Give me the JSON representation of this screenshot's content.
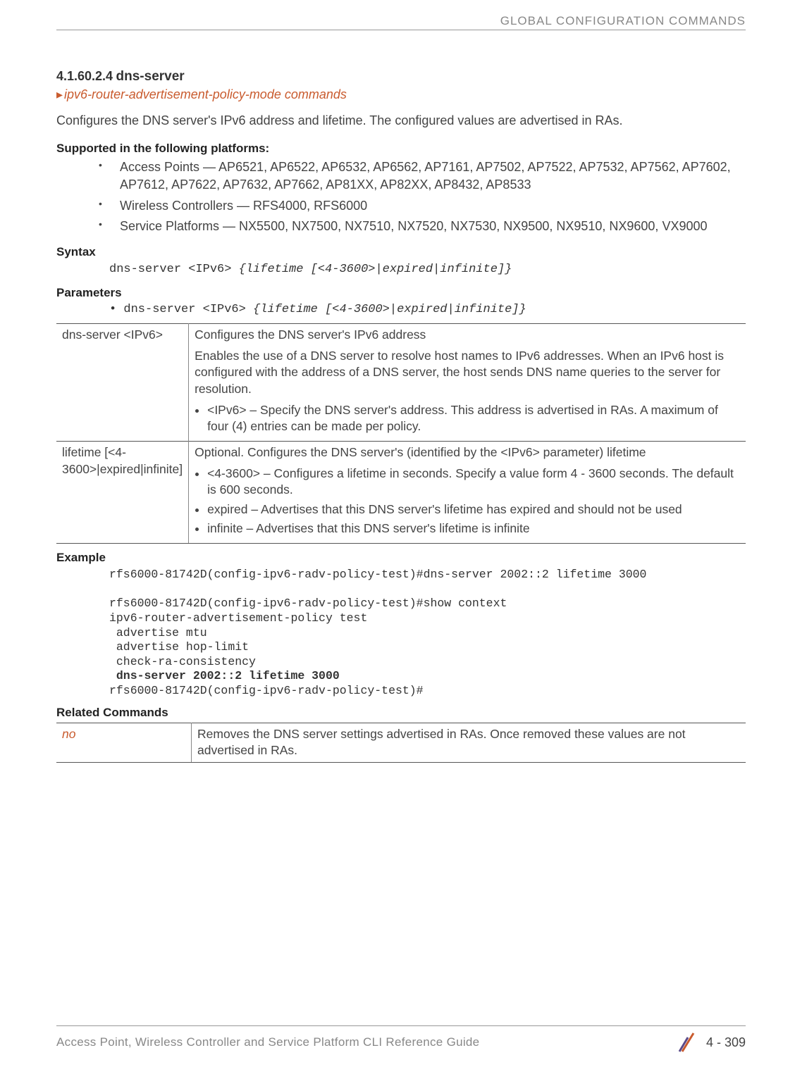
{
  "header": {
    "right": "GLOBAL CONFIGURATION COMMANDS"
  },
  "section": {
    "number": "4.1.60.2.4",
    "title": "dns-server"
  },
  "link": "ipv6-router-advertisement-policy-mode commands",
  "intro": "Configures the DNS server's IPv6 address and lifetime. The configured values are advertised in RAs.",
  "supported_head": "Supported in the following platforms:",
  "platforms": [
    "Access Points — AP6521, AP6522, AP6532, AP6562, AP7161, AP7502, AP7522, AP7532, AP7562, AP7602, AP7612, AP7622, AP7632, AP7662, AP81XX, AP82XX, AP8432, AP8533",
    "Wireless Controllers — RFS4000, RFS6000",
    "Service Platforms — NX5500, NX7500, NX7510, NX7520, NX7530, NX9500, NX9510, NX9600, VX9000"
  ],
  "syntax_head": "Syntax",
  "syntax": {
    "plain": "dns-server <IPv6> ",
    "italic": "{lifetime [<4-3600>|expired|infinite]}"
  },
  "parameters_head": "Parameters",
  "param_line": {
    "prefix": "• dns-server <IPv6> ",
    "italic": "{lifetime [<4-3600>|expired|infinite]}"
  },
  "table": {
    "r1": {
      "c1": "dns-server <IPv6>",
      "p1": "Configures the DNS server's IPv6 address",
      "p2": "Enables the use of a DNS server to resolve host names to IPv6 addresses. When an IPv6 host is configured with the address of a DNS server, the host sends DNS name queries to the server for resolution.",
      "b1": "<IPv6> – Specify the DNS server's address. This address is advertised in RAs. A maximum of four (4) entries can be made per policy."
    },
    "r2": {
      "c1": "lifetime [<4-3600>|expired|infinite]",
      "p1": "Optional. Configures the DNS server's (identified by the <IPv6> parameter) lifetime",
      "b1": "<4-3600> – Configures a lifetime in seconds. Specify a value form 4 - 3600 seconds. The default is 600 seconds.",
      "b2": "expired – Advertises that this DNS server's lifetime has expired and should not be used",
      "b3": "infinite – Advertises that this DNS server's lifetime is infinite"
    }
  },
  "example_head": "Example",
  "example": {
    "l1": "rfs6000-81742D(config-ipv6-radv-policy-test)#dns-server 2002::2 lifetime 3000",
    "l2": "rfs6000-81742D(config-ipv6-radv-policy-test)#show context",
    "l3": "ipv6-router-advertisement-policy test",
    "l4": " advertise mtu",
    "l5": " advertise hop-limit",
    "l6": " check-ra-consistency",
    "l7": " dns-server 2002::2 lifetime 3000",
    "l8": "rfs6000-81742D(config-ipv6-radv-policy-test)#"
  },
  "related_head": "Related Commands",
  "related": {
    "c1": "no",
    "c2": "Removes the DNS server settings advertised in RAs. Once removed these values are not advertised in RAs."
  },
  "footer": {
    "left": "Access Point, Wireless Controller and Service Platform CLI Reference Guide",
    "page": "4 - 309"
  }
}
